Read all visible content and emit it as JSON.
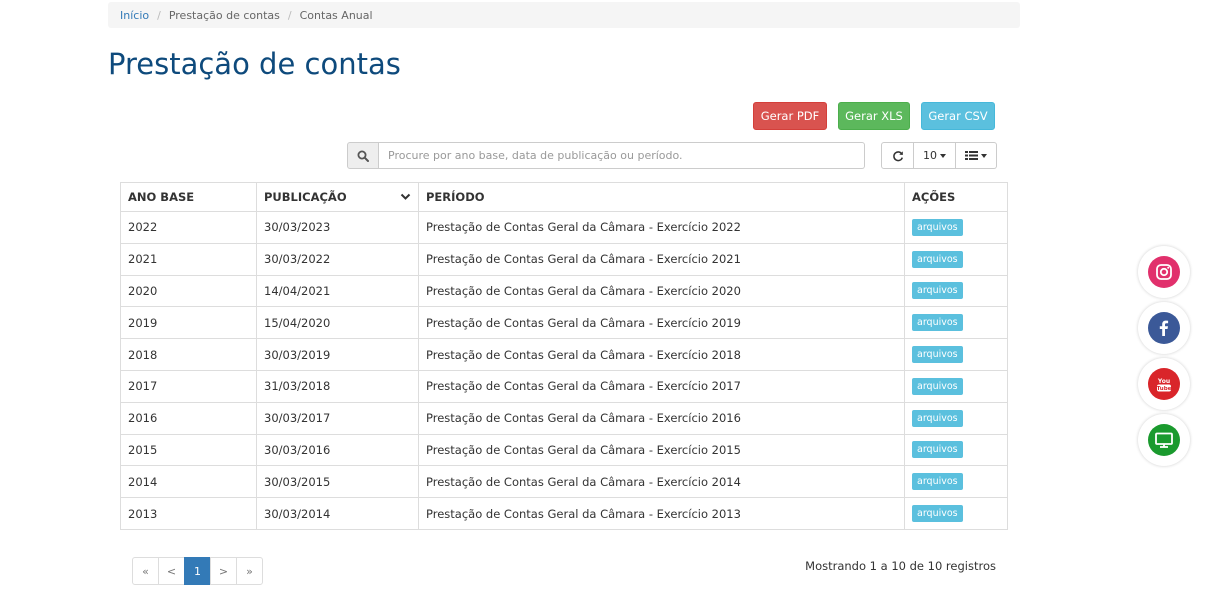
{
  "breadcrumb": {
    "home": "Início",
    "section": "Prestação de contas",
    "current": "Contas Anual"
  },
  "page": {
    "title": "Prestação de contas"
  },
  "export": {
    "pdf_label": "Gerar PDF",
    "xls_label": "Gerar XLS",
    "csv_label": "Gerar CSV"
  },
  "search": {
    "placeholder": "Procure por ano base, data de publicação ou período."
  },
  "toolbar": {
    "page_size": "10"
  },
  "table": {
    "headers": {
      "year": "ANO BASE",
      "publication": "PUBLICAÇÃO",
      "period": "PERÍODO",
      "actions": "AÇÕES"
    },
    "rows": [
      {
        "year": "2022",
        "publication": "30/03/2023",
        "period": "Prestação de Contas Geral da Câmara - Exercício 2022",
        "action": "arquivos"
      },
      {
        "year": "2021",
        "publication": "30/03/2022",
        "period": "Prestação de Contas Geral da Câmara - Exercício 2021",
        "action": "arquivos"
      },
      {
        "year": "2020",
        "publication": "14/04/2021",
        "period": "Prestação de Contas Geral da Câmara - Exercício 2020",
        "action": "arquivos"
      },
      {
        "year": "2019",
        "publication": "15/04/2020",
        "period": "Prestação de Contas Geral da Câmara - Exercício 2019",
        "action": "arquivos"
      },
      {
        "year": "2018",
        "publication": "30/03/2019",
        "period": "Prestação de Contas Geral da Câmara - Exercício 2018",
        "action": "arquivos"
      },
      {
        "year": "2017",
        "publication": "31/03/2018",
        "period": "Prestação de Contas Geral da Câmara - Exercício 2017",
        "action": "arquivos"
      },
      {
        "year": "2016",
        "publication": "30/03/2017",
        "period": "Prestação de Contas Geral da Câmara - Exercício 2016",
        "action": "arquivos"
      },
      {
        "year": "2015",
        "publication": "30/03/2016",
        "period": "Prestação de Contas Geral da Câmara - Exercício 2015",
        "action": "arquivos"
      },
      {
        "year": "2014",
        "publication": "30/03/2015",
        "period": "Prestação de Contas Geral da Câmara - Exercício 2014",
        "action": "arquivos"
      },
      {
        "year": "2013",
        "publication": "30/03/2014",
        "period": "Prestação de Contas Geral da Câmara - Exercício 2013",
        "action": "arquivos"
      }
    ]
  },
  "pagination": {
    "first": "«",
    "prev": "<",
    "current": "1",
    "next": ">",
    "last": "»"
  },
  "records_info": "Mostrando 1 a 10 de 10 registros",
  "social": [
    {
      "icon": "instagram-icon",
      "color": "#e1306c"
    },
    {
      "icon": "facebook-icon",
      "color": "#3b5998"
    },
    {
      "icon": "youtube-icon",
      "color": "#d9252a"
    },
    {
      "icon": "tv-icon",
      "color": "#1a9a2e"
    }
  ]
}
